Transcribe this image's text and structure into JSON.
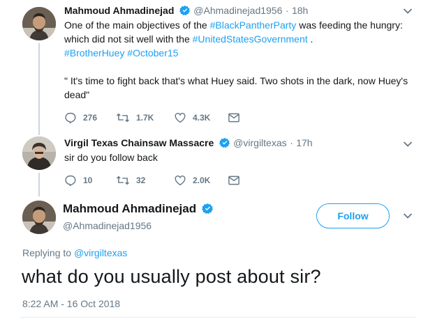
{
  "tweet1": {
    "name": "Mahmoud Ahmadinejad",
    "handle": "@Ahmadinejad1956",
    "sep": "·",
    "time": "18h",
    "line1_pre": "One of the main objectives of the ",
    "line1_link": "#BlackPantherParty",
    "line1_post": " was feeding the hungry:",
    "line2_pre": "which did not sit well with the ",
    "line2_link": "#UnitedStatesGovernment",
    "line2_post": " .",
    "hashtag3": "#BrotherHuey",
    "hashtag4": "#October15",
    "quote_line1": "\" It's time to fight back that's what Huey said. Two shots in the dark, now Huey's",
    "quote_line2": "dead\"",
    "replies": "276",
    "retweets": "1.7K",
    "likes": "4.3K"
  },
  "tweet2": {
    "name": "Virgil Texas Chainsaw Massacre",
    "handle": "@virgiltexas",
    "sep": "·",
    "time": "17h",
    "text": "sir do you follow back",
    "replies": "10",
    "retweets": "32",
    "likes": "2.0K"
  },
  "main_tweet": {
    "name": "Mahmoud Ahmadinejad",
    "handle": "@Ahmadinejad1956",
    "follow_label": "Follow",
    "replying_prefix": "Replying to ",
    "replying_to": "@virgiltexas",
    "text": "what do you usually post about sir?",
    "timestamp": "8:22 AM - 16 Oct 2018"
  },
  "colors": {
    "link": "#1da1f2",
    "muted": "#657786",
    "text": "#14171a",
    "verified": "#1da1f2"
  },
  "icons": [
    "reply-icon",
    "retweet-icon",
    "like-icon",
    "direct-message-icon",
    "chevron-down-icon",
    "verified-badge-icon"
  ]
}
